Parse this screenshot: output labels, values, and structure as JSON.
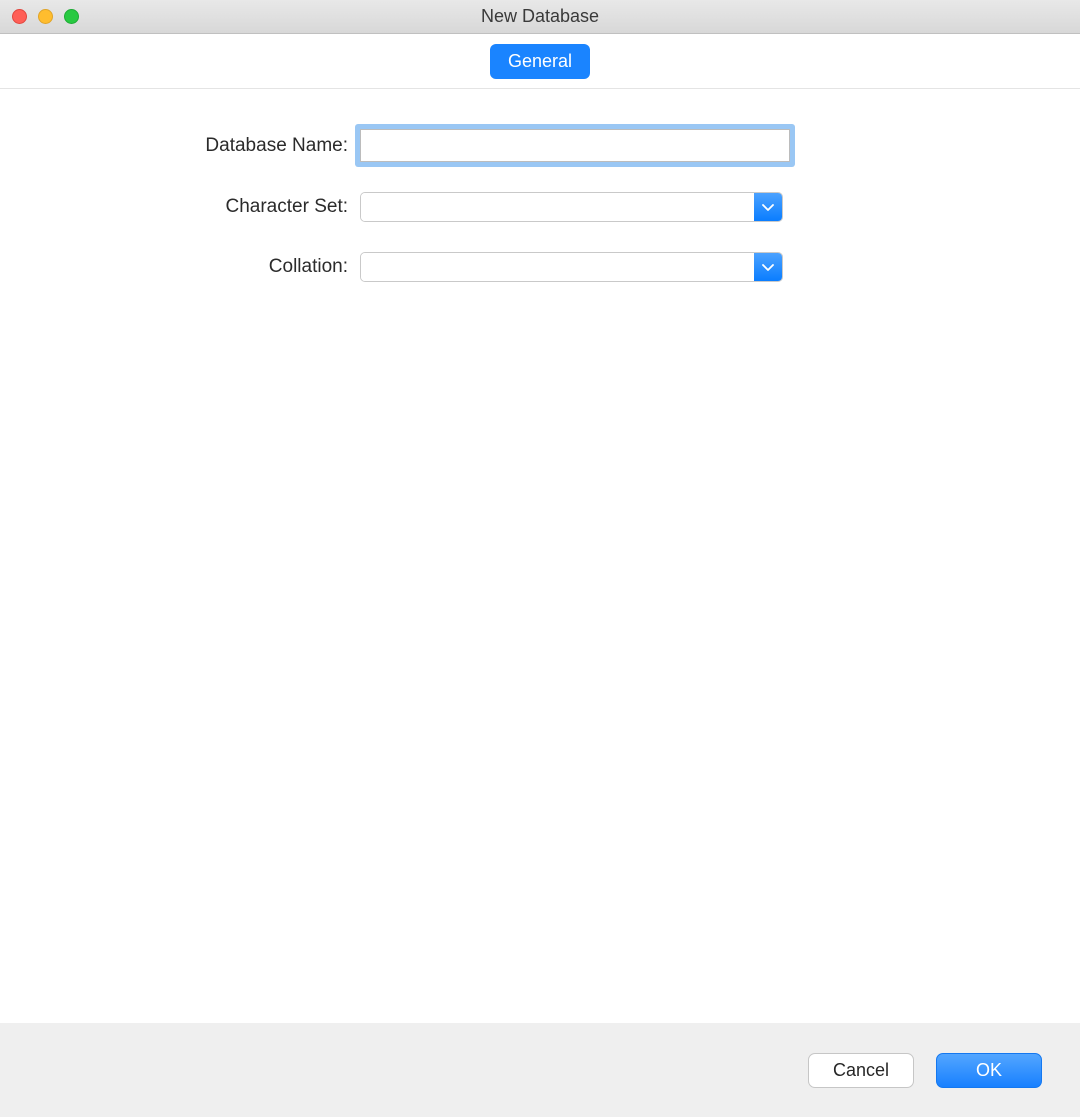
{
  "window": {
    "title": "New Database"
  },
  "tabs": {
    "general": "General"
  },
  "form": {
    "database_name": {
      "label": "Database Name:",
      "value": ""
    },
    "character_set": {
      "label": "Character Set:",
      "value": ""
    },
    "collation": {
      "label": "Collation:",
      "value": ""
    }
  },
  "footer": {
    "cancel": "Cancel",
    "ok": "OK"
  }
}
